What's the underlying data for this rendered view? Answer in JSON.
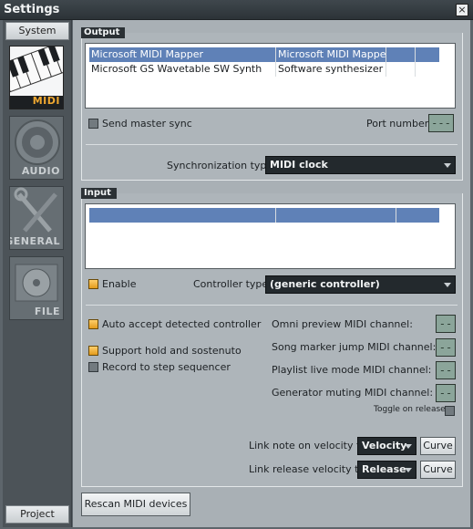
{
  "window": {
    "title": "Settings",
    "close_glyph": "×"
  },
  "sidebar": {
    "top_tab": "System",
    "bottom_tab": "Project",
    "items": [
      {
        "label": "MIDI",
        "icon": "midi-keyboard-icon",
        "active": true
      },
      {
        "label": "AUDIO",
        "icon": "speaker-icon"
      },
      {
        "label": "GENERAL",
        "icon": "tools-icon"
      },
      {
        "label": "FILE",
        "icon": "disc-icon"
      }
    ]
  },
  "output": {
    "title": "Output",
    "devices": [
      {
        "name": "Microsoft MIDI Mapper",
        "type": "Microsoft MIDI Mapper",
        "selected": true
      },
      {
        "name": "Microsoft GS Wavetable SW Synth",
        "type": "Software synthesizer",
        "selected": false
      }
    ],
    "send_master_sync": "Send master sync",
    "port_number_label": "Port number:",
    "port_number_value": "---",
    "sync_type_label": "Synchronization type:",
    "sync_type_value": "MIDI clock"
  },
  "input": {
    "title": "Input",
    "enable_label": "Enable",
    "controller_type_label": "Controller type:",
    "controller_type_value": "(generic controller)",
    "auto_accept": "Auto accept detected controller",
    "support_hold": "Support hold and sostenuto",
    "record_step": "Record to step sequencer",
    "channels": [
      {
        "label": "Omni preview MIDI channel:",
        "value": "--"
      },
      {
        "label": "Song marker jump MIDI channel:",
        "value": "--"
      },
      {
        "label": "Playlist live mode MIDI channel:",
        "value": "--"
      },
      {
        "label": "Generator muting MIDI channel:",
        "value": "--"
      }
    ],
    "toggle_on_release": "Toggle on release",
    "link_note_label": "Link note on velocity to:",
    "link_note_value": "Velocity",
    "link_release_label": "Link release velocity to:",
    "link_release_value": "Release",
    "curve_label": "Curve",
    "rescan_label": "Rescan MIDI devices"
  },
  "colors": {
    "accent": "#5f81b7",
    "checkbox_on": "#f0b43a",
    "lcd": "#8ba59a"
  }
}
